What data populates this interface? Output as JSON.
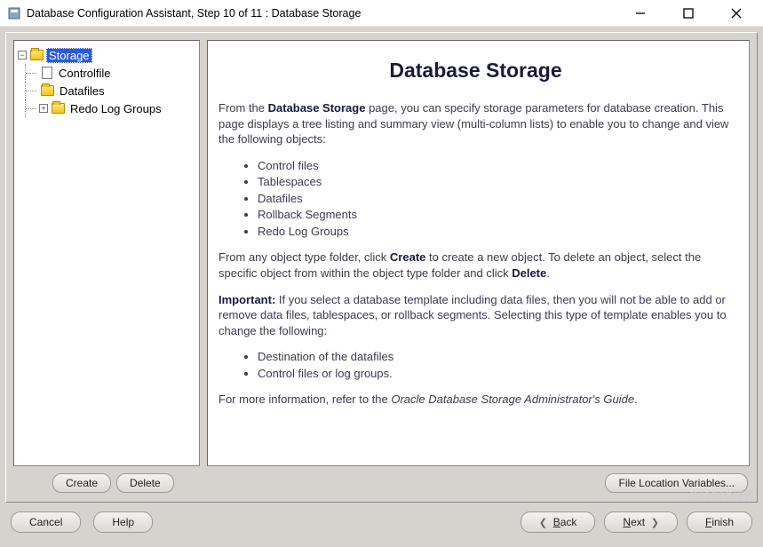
{
  "window": {
    "title": "Database Configuration Assistant, Step 10 of 11 : Database Storage"
  },
  "tree": {
    "root": {
      "label": "Storage"
    },
    "children": [
      {
        "label": "Controlfile"
      },
      {
        "label": "Datafiles"
      },
      {
        "label": "Redo Log Groups"
      }
    ]
  },
  "content": {
    "heading": "Database Storage",
    "para1_pre": "From the ",
    "para1_bold": "Database Storage",
    "para1_post": " page, you can specify storage parameters for database creation. This page displays a tree listing and summary view (multi-column lists) to enable you to change and view the following objects:",
    "bullets1": [
      "Control files",
      "Tablespaces",
      "Datafiles",
      "Rollback Segments",
      "Redo Log Groups"
    ],
    "para2_pre": "From any object type folder, click ",
    "para2_b1": "Create",
    "para2_mid": " to create a new object. To delete an object, select the specific object from within the object type folder and click ",
    "para2_b2": "Delete",
    "para2_post": ".",
    "para3_b": "Important:",
    "para3_rest": " If you select a database template including data files, then you will not be able to add or remove data files, tablespaces, or rollback segments. Selecting this type of template enables you to change the following:",
    "bullets2": [
      "Destination of the datafiles",
      "Control files or log groups."
    ],
    "para4_pre": "For more information, refer to the ",
    "para4_italic": "Oracle Database Storage Administrator's Guide",
    "para4_post": "."
  },
  "buttons": {
    "create": "Create",
    "delete": "Delete",
    "file_loc": "File Location Variables...",
    "cancel": "Cancel",
    "help": "Help",
    "back": "Back",
    "next": "Next",
    "finish": "Finish"
  },
  "watermark": "@51CTO博客"
}
